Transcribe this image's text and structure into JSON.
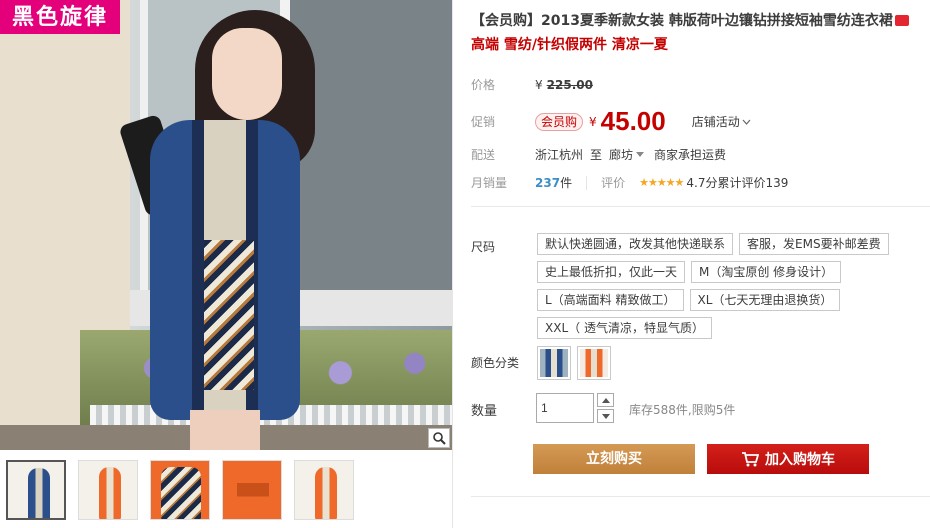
{
  "brand": {
    "logo_text": "黑色旋律"
  },
  "product": {
    "title": "【会员购】2013夏季新款女装 韩版荷叶边镶钻拼接短袖雪纺连衣裙",
    "subtitle": "高端 雪纺/针织假两件 清凉一夏"
  },
  "pricing": {
    "orig_label": "价格",
    "currency": "¥",
    "orig_price": "225.00",
    "promo_label": "促销",
    "promo_badge": "会员购",
    "promo_price": "45.00",
    "shop_activity": "店铺活动"
  },
  "shipping": {
    "label": "配送",
    "from": "浙江杭州",
    "to_word": "至",
    "to": "廊坊",
    "fee": "商家承担运费"
  },
  "sales": {
    "label": "月销量",
    "count": "237",
    "unit": "件",
    "rating_label": "评价",
    "stars": "★★★★★",
    "score": "4.7分",
    "total_reviews_label": "累计评价",
    "total_reviews": "139"
  },
  "sku": {
    "size_label": "尺码",
    "sizes": [
      "默认快递圆通，改发其他快递联系",
      "客服，发EMS要补邮差费",
      "史上最低折扣，仅此一天",
      "M（淘宝原创 修身设计）",
      "L（高端面料 精致做工）",
      "XL（七天无理由退换货）",
      "XXL（ 透气清凉，特显气质）"
    ],
    "color_label": "颜色分类",
    "colors": [
      "blue-swatch",
      "orange-swatch"
    ]
  },
  "quantity": {
    "label": "数量",
    "value": "1",
    "stock_text": "库存588件,限购5件"
  },
  "actions": {
    "buy_now": "立刻购买",
    "add_cart": "加入购物车"
  },
  "colors": {
    "accent_red": "#c40000",
    "buy_button": "#c88c44",
    "cart_button": "#c40c0c"
  }
}
